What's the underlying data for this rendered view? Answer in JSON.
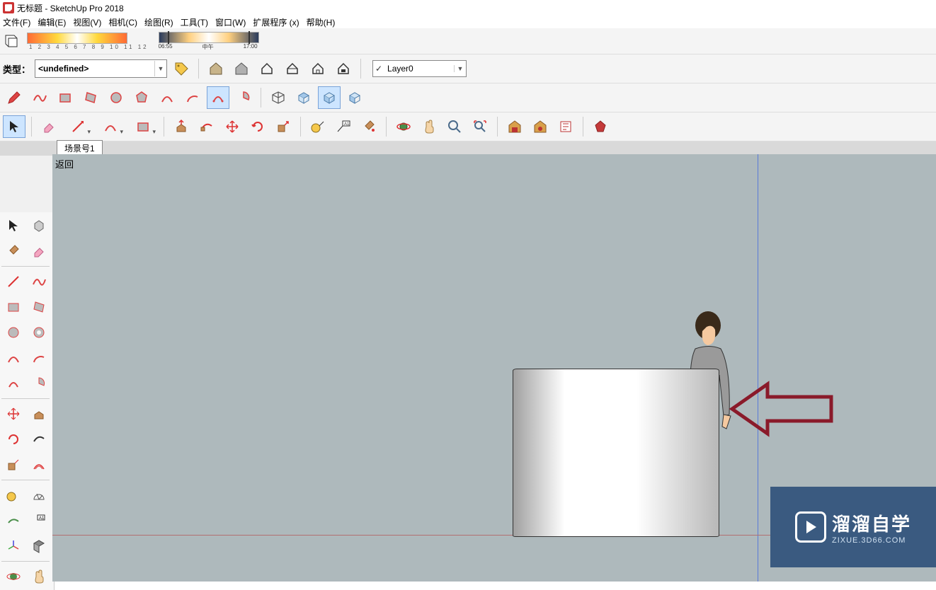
{
  "title": {
    "text": "无标题 - SketchUp Pro 2018"
  },
  "menu": {
    "file": "文件(F)",
    "edit": "编辑(E)",
    "view": "视图(V)",
    "camera": "相机(C)",
    "draw": "绘图(R)",
    "tools": "工具(T)",
    "window": "窗口(W)",
    "extensions": "扩展程序 (x)",
    "help": "帮助(H)"
  },
  "shadow_bar": {
    "sun_ticks": "1 2 3 4 5 6 7 8 9 10 11 12",
    "time_start": "06:55",
    "time_mid": "中午",
    "time_end": "17:00"
  },
  "type_bar": {
    "label": "类型：",
    "value": "<undefined>"
  },
  "layer": {
    "value": "Layer0"
  },
  "scene": {
    "tab1": "场景号1"
  },
  "viewport": {
    "back_label": "返回"
  },
  "watermark": {
    "title": "溜溜自学",
    "subtitle": "ZIXUE.3D66.COM"
  },
  "icons": {
    "house1": "house-icon",
    "house2": "house-icon",
    "house3": "house-icon",
    "house4": "house-icon",
    "house5": "house-icon",
    "house6": "house-icon",
    "pencil": "pencil-icon",
    "freehand": "freehand-icon",
    "rect": "rectangle-icon",
    "rrect": "rotated-rectangle-icon",
    "circle": "circle-icon",
    "poly": "polygon-icon",
    "arc1": "arc-icon",
    "arc2": "arc2-icon",
    "arc3": "arc3-icon",
    "pie": "pie-icon",
    "iso": "iso-icon",
    "top": "top-icon",
    "front": "front-icon",
    "back": "back-icon",
    "select": "select-icon",
    "eraser": "eraser-icon",
    "line": "line-icon",
    "arc": "arc-icon",
    "rect2": "rect-icon",
    "pushpull": "pushpull-icon",
    "followme": "followme-icon",
    "move": "move-icon",
    "rotate": "rotate-icon",
    "scale": "scale-icon",
    "tape": "tape-icon",
    "text": "text-icon",
    "paint": "paint-icon",
    "orbit": "orbit-icon",
    "pan": "pan-icon",
    "zoom": "zoom-icon",
    "zoomext": "zoom-extents-icon",
    "wh1": "warehouse-icon",
    "wh2": "warehouse-icon",
    "wh3": "warehouse-icon",
    "ruby": "ruby-icon",
    "tag": "tag-icon"
  },
  "left_tools": [
    "select",
    "component",
    "paint",
    "eraser",
    "line",
    "freehand",
    "rect",
    "rrect",
    "circle",
    "poly",
    "arc",
    "arc2",
    "arc3",
    "pie",
    "move",
    "pushpull",
    "rotate",
    "followme",
    "scale",
    "offset",
    "tape",
    "protractor",
    "dimension",
    "text",
    "axes",
    "section",
    "orbit",
    "pan"
  ]
}
